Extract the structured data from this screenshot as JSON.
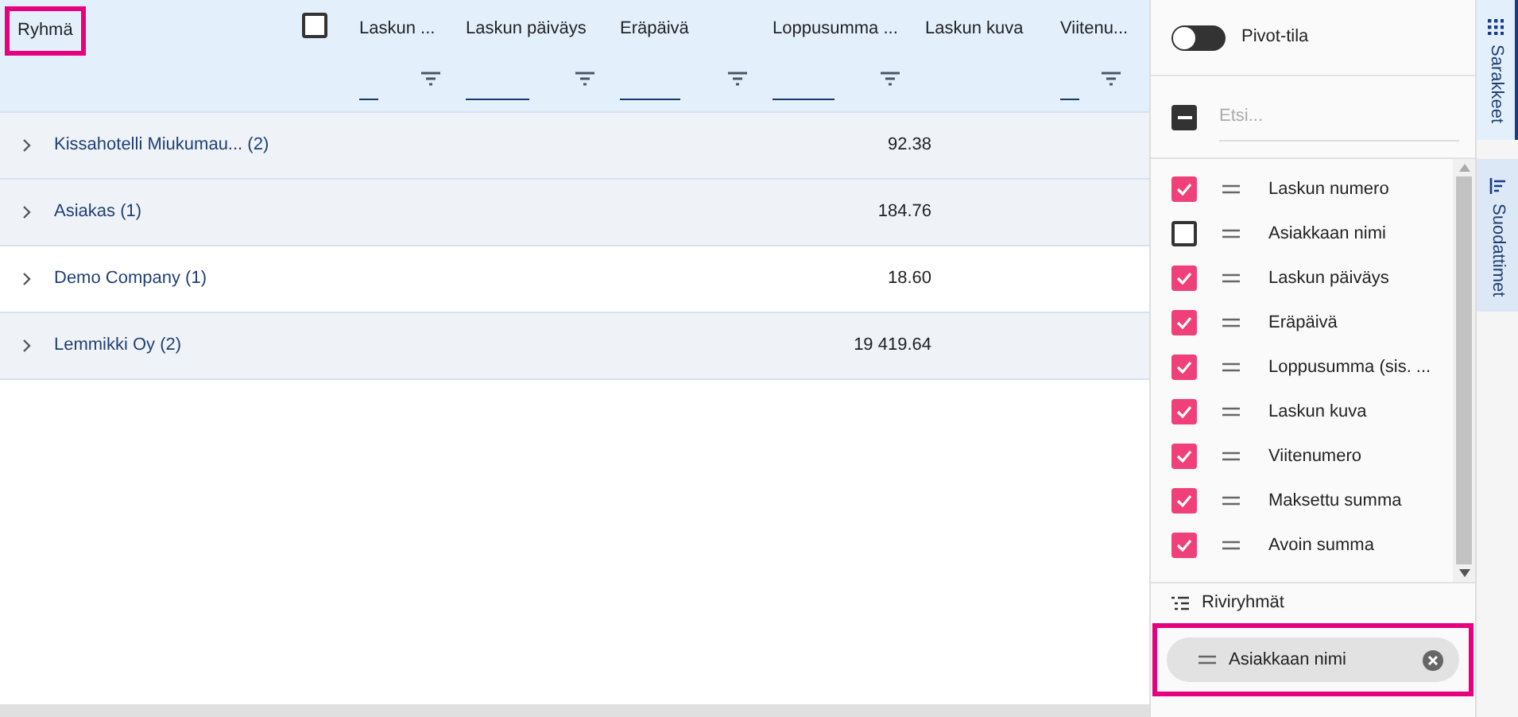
{
  "header": {
    "group_column": {
      "label": "Ryhmä",
      "highlighted": true
    },
    "select_all": {
      "checked": false
    },
    "columns": [
      {
        "label": "Laskun ...",
        "filter": true
      },
      {
        "label": "Laskun päiväys",
        "filter": true
      },
      {
        "label": "Eräpäivä",
        "filter": true
      },
      {
        "label": "Loppusumma ...",
        "filter": true
      },
      {
        "label": "Laskun kuva",
        "filter": false
      },
      {
        "label": "Viitenu...",
        "filter": true
      }
    ]
  },
  "rows": [
    {
      "group": "Kissahotelli Miukumau...",
      "count": "(2)",
      "amount": "92.38",
      "expanded": false,
      "shaded": true
    },
    {
      "group": "Asiakas",
      "count": "(1)",
      "amount": "184.76",
      "expanded": false,
      "shaded": true
    },
    {
      "group": "Demo Company",
      "count": "(1)",
      "amount": "18.60",
      "expanded": false,
      "shaded": false
    },
    {
      "group": "Lemmikki Oy",
      "count": "(2)",
      "amount": "19 419.64",
      "expanded": false,
      "shaded": true
    }
  ],
  "panel": {
    "pivot": {
      "label": "Pivot-tila",
      "on": false
    },
    "select_all": {
      "indeterminate": true
    },
    "search": {
      "placeholder": "Etsi..."
    },
    "column_list": [
      {
        "label": "Laskun numero",
        "checked": true
      },
      {
        "label": "Asiakkaan nimi",
        "checked": false
      },
      {
        "label": "Laskun päiväys",
        "checked": true
      },
      {
        "label": "Eräpäivä",
        "checked": true
      },
      {
        "label": "Loppusumma (sis. ...",
        "checked": true
      },
      {
        "label": "Laskun kuva",
        "checked": true
      },
      {
        "label": "Viitenumero",
        "checked": true
      },
      {
        "label": "Maksettu summa",
        "checked": true
      },
      {
        "label": "Avoin summa",
        "checked": true
      }
    ],
    "row_groups": {
      "title": "Riviryhmät",
      "highlighted": true,
      "chips": [
        {
          "label": "Asiakkaan nimi"
        }
      ]
    }
  },
  "side_tabs": [
    {
      "label": "Sarakkeet",
      "kind": "columns",
      "selected": true
    },
    {
      "label": "Suodattimet",
      "kind": "filters",
      "selected": false
    }
  ]
}
